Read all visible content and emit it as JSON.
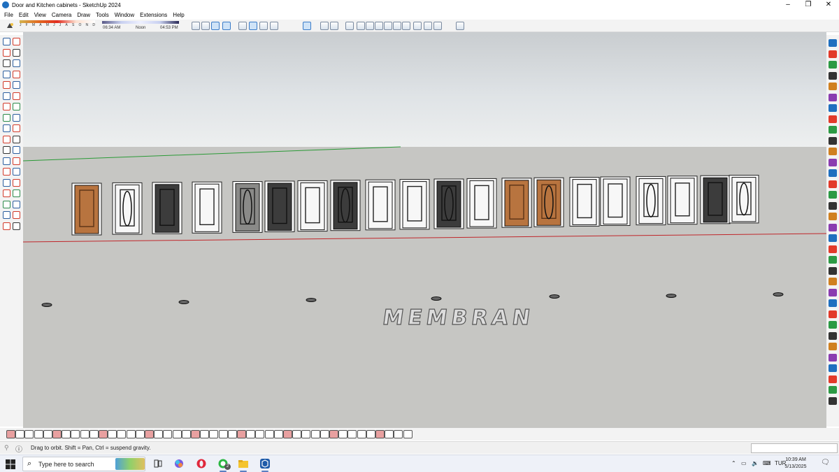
{
  "window": {
    "title": "Door and Kitchen cabinets - SketchUp 2024",
    "controls": [
      "minimize-icon",
      "restore-icon",
      "close-icon"
    ]
  },
  "menu": [
    "File",
    "Edit",
    "View",
    "Camera",
    "Draw",
    "Tools",
    "Window",
    "Extensions",
    "Help"
  ],
  "shadows": {
    "months": [
      "J",
      "F",
      "M",
      "A",
      "M",
      "J",
      "J",
      "A",
      "S",
      "O",
      "N",
      "D"
    ],
    "times": [
      "06:34 AM",
      "Noon",
      "04:53 PM"
    ]
  },
  "viewport": {
    "text3d": "MEMBRAN",
    "colors": {
      "sky_top": "#c9cdd0",
      "sky_bottom": "#edefef",
      "ground": "#c6c6c3",
      "red_axis": "#c0262a",
      "green_axis": "#2a9a36",
      "wood": "#b8743f",
      "dark": "#3c3c3c",
      "white_door": "#f7f7f7"
    }
  },
  "statusbar": {
    "text": "Drag to orbit. Shift = Pan, Ctrl = suspend gravity."
  },
  "taskbar": {
    "search_placeholder": "Type here to search",
    "language": "TUR",
    "time": "10:39 AM",
    "date": "5/13/2025",
    "whatsapp_badge": "2"
  }
}
